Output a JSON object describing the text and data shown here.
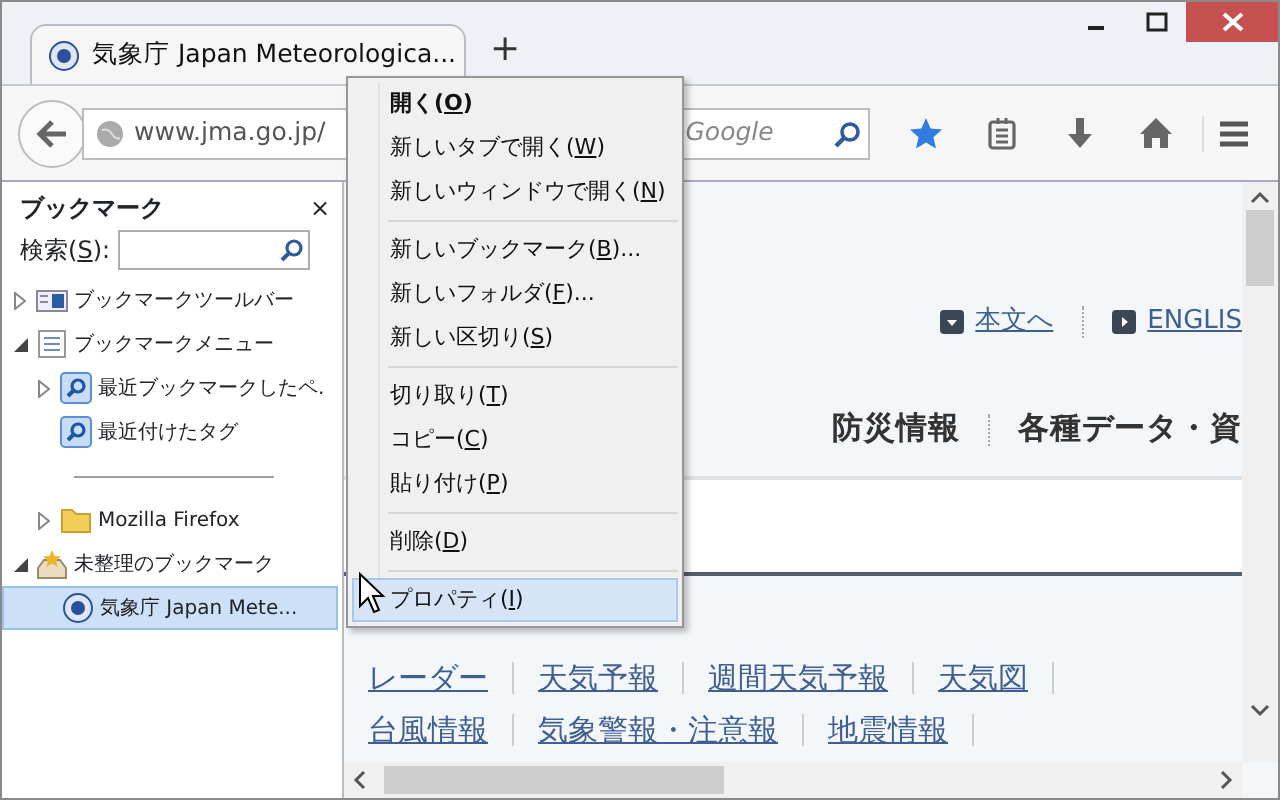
{
  "tabs": [
    {
      "title": "気象庁 Japan Meteorologica...",
      "selected": true
    }
  ],
  "new_tab": "+",
  "toolbar": {
    "url": "www.jma.go.jp/",
    "search": {
      "placeholder": "Google"
    }
  },
  "sidebar": {
    "title": "ブックマーク",
    "close": "×",
    "search_label": {
      "before": "検索(",
      "key": "S",
      "after": "):"
    },
    "tree": [
      {
        "label": "ブックマークツールバー",
        "kind": "toolbar",
        "expanded": false,
        "selected": false
      },
      {
        "label": "ブックマークメニュー",
        "kind": "menu",
        "expanded": true,
        "selected": false,
        "children": [
          {
            "label": "最近ブックマークしたペ.",
            "kind": "query",
            "expanded": false,
            "selected": false
          },
          {
            "label": "最近付けたタグ",
            "kind": "query",
            "selected": false
          },
          {
            "kind": "separator"
          },
          {
            "label": "Mozilla Firefox",
            "kind": "folder",
            "expanded": false,
            "selected": false
          }
        ]
      },
      {
        "label": "未整理のブックマーク",
        "kind": "unsorted",
        "expanded": true,
        "selected": false,
        "children": [
          {
            "label": "気象庁 Japan Mete...",
            "kind": "page",
            "selected": true
          }
        ]
      }
    ]
  },
  "context_menu": {
    "items": [
      {
        "kind": "item",
        "before": "開く(",
        "key": "O",
        "after": ")",
        "default": true,
        "selected": false
      },
      {
        "kind": "item",
        "before": "新しいタブで開く(",
        "key": "W",
        "after": ")",
        "default": false,
        "selected": false
      },
      {
        "kind": "item",
        "before": "新しいウィンドウで開く(",
        "key": "N",
        "after": ")",
        "default": false,
        "selected": false
      },
      {
        "kind": "separator"
      },
      {
        "kind": "item",
        "before": "新しいブックマーク(",
        "key": "B",
        "after": ")...",
        "default": false,
        "selected": false
      },
      {
        "kind": "item",
        "before": "新しいフォルダ(",
        "key": "F",
        "after": ")...",
        "default": false,
        "selected": false
      },
      {
        "kind": "item",
        "before": "新しい区切り(",
        "key": "S",
        "after": ")",
        "default": false,
        "selected": false
      },
      {
        "kind": "separator"
      },
      {
        "kind": "item",
        "before": "切り取り(",
        "key": "T",
        "after": ")",
        "default": false,
        "selected": false
      },
      {
        "kind": "item",
        "before": "コピー(",
        "key": "C",
        "after": ")",
        "default": false,
        "selected": false
      },
      {
        "kind": "item",
        "before": "貼り付け(",
        "key": "P",
        "after": ")",
        "default": false,
        "selected": false
      },
      {
        "kind": "separator"
      },
      {
        "kind": "item",
        "before": "削除(",
        "key": "D",
        "after": ")",
        "default": false,
        "selected": false
      },
      {
        "kind": "separator"
      },
      {
        "kind": "item",
        "before": "プロパティ(",
        "key": "I",
        "after": ")",
        "default": false,
        "selected": true
      }
    ]
  },
  "page": {
    "skip_links": [
      {
        "label": "本文へ",
        "kind": "down"
      },
      {
        "label": "ENGLIS",
        "kind": "right"
      }
    ],
    "nav": [
      "防災情報",
      "各種データ・資"
    ],
    "links": [
      [
        "レーダー",
        "天気予報",
        "週間天気予報",
        "天気図"
      ],
      [
        "台風情報",
        "気象警報・注意報",
        "地震情報"
      ]
    ]
  }
}
